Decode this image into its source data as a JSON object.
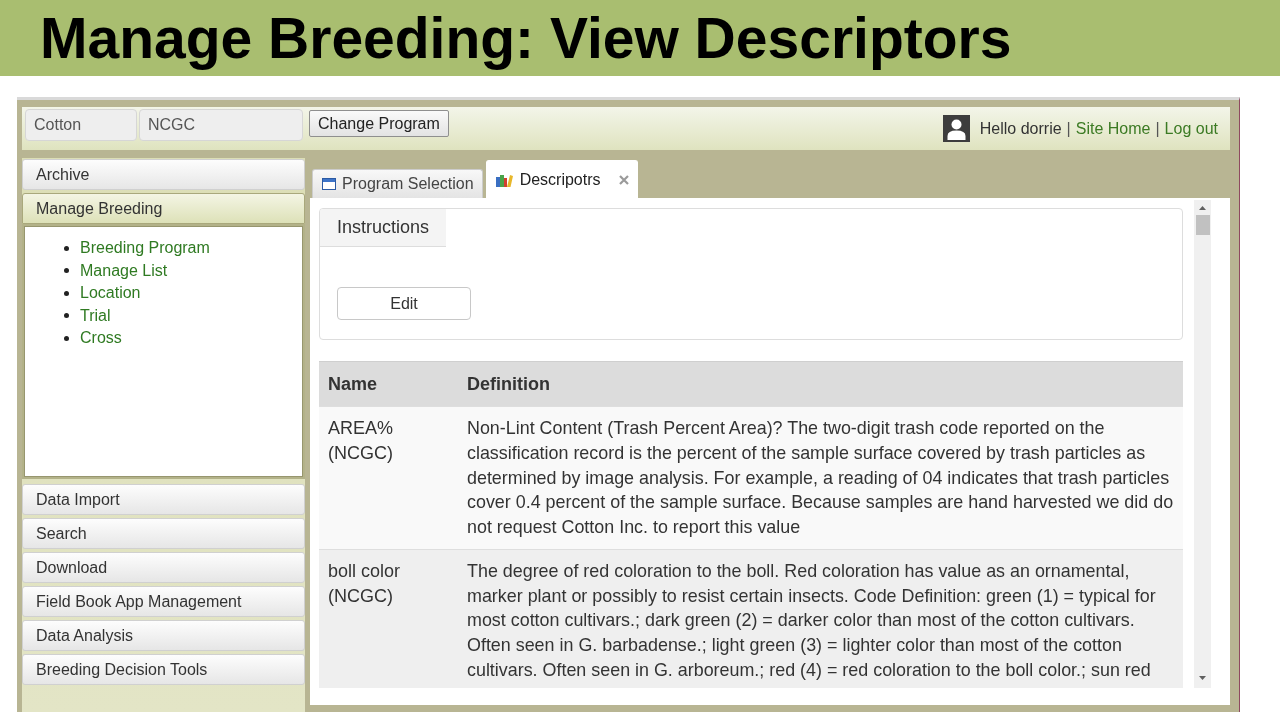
{
  "slide_title": "Manage Breeding: View Descriptors",
  "header": {
    "fields": [
      {
        "value": "Cotton"
      },
      {
        "value": "NCGC"
      }
    ],
    "change_button": "Change Program",
    "user_bar": [
      {
        "kind": "text",
        "label": "Hello dorrie"
      },
      {
        "kind": "separator",
        "label": "|"
      },
      {
        "kind": "link",
        "label": "Site Home"
      },
      {
        "kind": "separator",
        "label": "|"
      },
      {
        "kind": "link",
        "label": "Log out"
      }
    ]
  },
  "sidebar": {
    "sections": [
      {
        "label": "Archive",
        "expanded": false
      },
      {
        "label": "Manage Breeding",
        "expanded": true,
        "items": [
          "Breeding Program",
          "Manage List",
          "Location",
          "Trial",
          "Cross"
        ]
      },
      {
        "label": "Data Import",
        "expanded": false
      },
      {
        "label": "Search",
        "expanded": false
      },
      {
        "label": "Download",
        "expanded": false
      },
      {
        "label": "Field Book App Management",
        "expanded": false
      },
      {
        "label": "Data Analysis",
        "expanded": false
      },
      {
        "label": "Breeding Decision Tools",
        "expanded": false
      }
    ]
  },
  "tabs": [
    {
      "label": "Program Selection",
      "selected": false,
      "closable": false
    },
    {
      "label": "Descripotrs",
      "selected": true,
      "closable": true
    }
  ],
  "instructions": {
    "tab": "Instructions",
    "edit_button": "Edit"
  },
  "table": {
    "columns": [
      "Name",
      "Definition"
    ],
    "rows": [
      {
        "name": "AREA% (NCGC)",
        "definition": "Non-Lint Content (Trash Percent Area)? The two-digit trash code reported on the classification record is the percent of the sample surface covered by trash particles as determined by image analysis. For example, a reading of 04 indicates that trash particles cover 0.4 percent of the sample surface. Because samples are hand harvested we did do not request Cotton Inc. to report this value"
      },
      {
        "name": "boll color (NCGC)",
        "definition": "The degree of red coloration to the boll. Red coloration has value as an ornamental, marker plant or possibly to resist certain insects. Code Definition: green (1) = typical for most cotton cultivars.; dark green (2) = darker color than most of the cotton cultivars. Often seen in G. barbadense.; light green (3) = lighter color than most of the cotton cultivars. Often seen in G. arboreum.; red (4) = red coloration to the boll color.; sun red"
      }
    ]
  }
}
